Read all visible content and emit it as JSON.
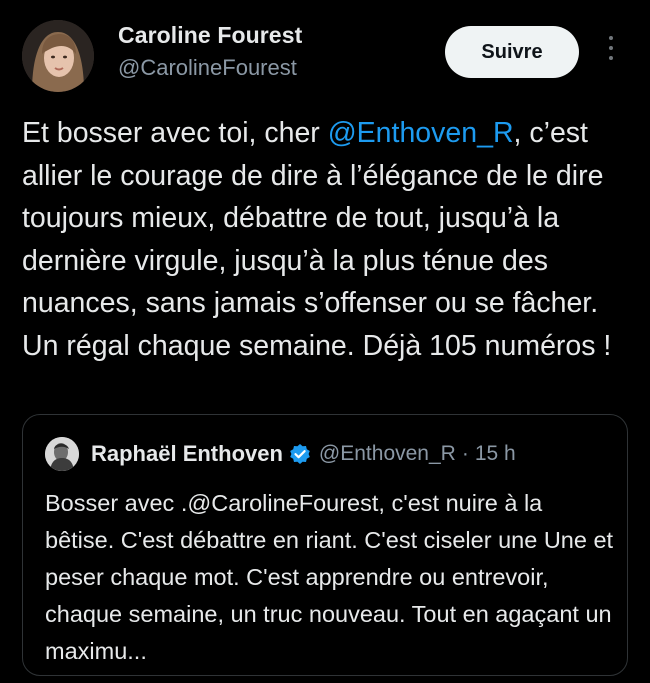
{
  "author": {
    "display_name": "Caroline Fourest",
    "handle": "@CarolineFourest",
    "avatar_icon": "profile-photo"
  },
  "follow_button": {
    "label": "Suivre"
  },
  "more_menu": {
    "icon": "vertical-ellipsis-icon"
  },
  "tweet": {
    "text_before_mention": "Et bosser avec toi, cher ",
    "mention": "@Enthoven_R",
    "text_after_mention": ", c’est allier le courage de dire à l’élégance de le dire toujours mieux, débattre de tout, jusqu’à la dernière virgule, jusqu’à la plus ténue des nuances, sans jamais s’offenser ou se fâcher. Un régal chaque semaine. Déjà 105 numéros !"
  },
  "quoted_tweet": {
    "display_name": "Raphaël Enthoven",
    "handle": "@Enthoven_R",
    "separator": "·",
    "timestamp": "15 h",
    "verified_icon": "verified-badge-icon",
    "text": "Bosser avec .@CarolineFourest, c'est nuire à la bêtise. C'est débattre en riant. C'est ciseler une Une et peser chaque mot. C'est apprendre ou entrevoir, chaque semaine, un truc nouveau. Tout en agaçant un maximu..."
  },
  "colors": {
    "background": "#000000",
    "text": "#e7e9ea",
    "secondary_text": "#8b98a5",
    "link": "#1d9bf0",
    "verified": "#1d9bf0",
    "button_bg": "#eff3f4",
    "border": "#2f3336"
  }
}
